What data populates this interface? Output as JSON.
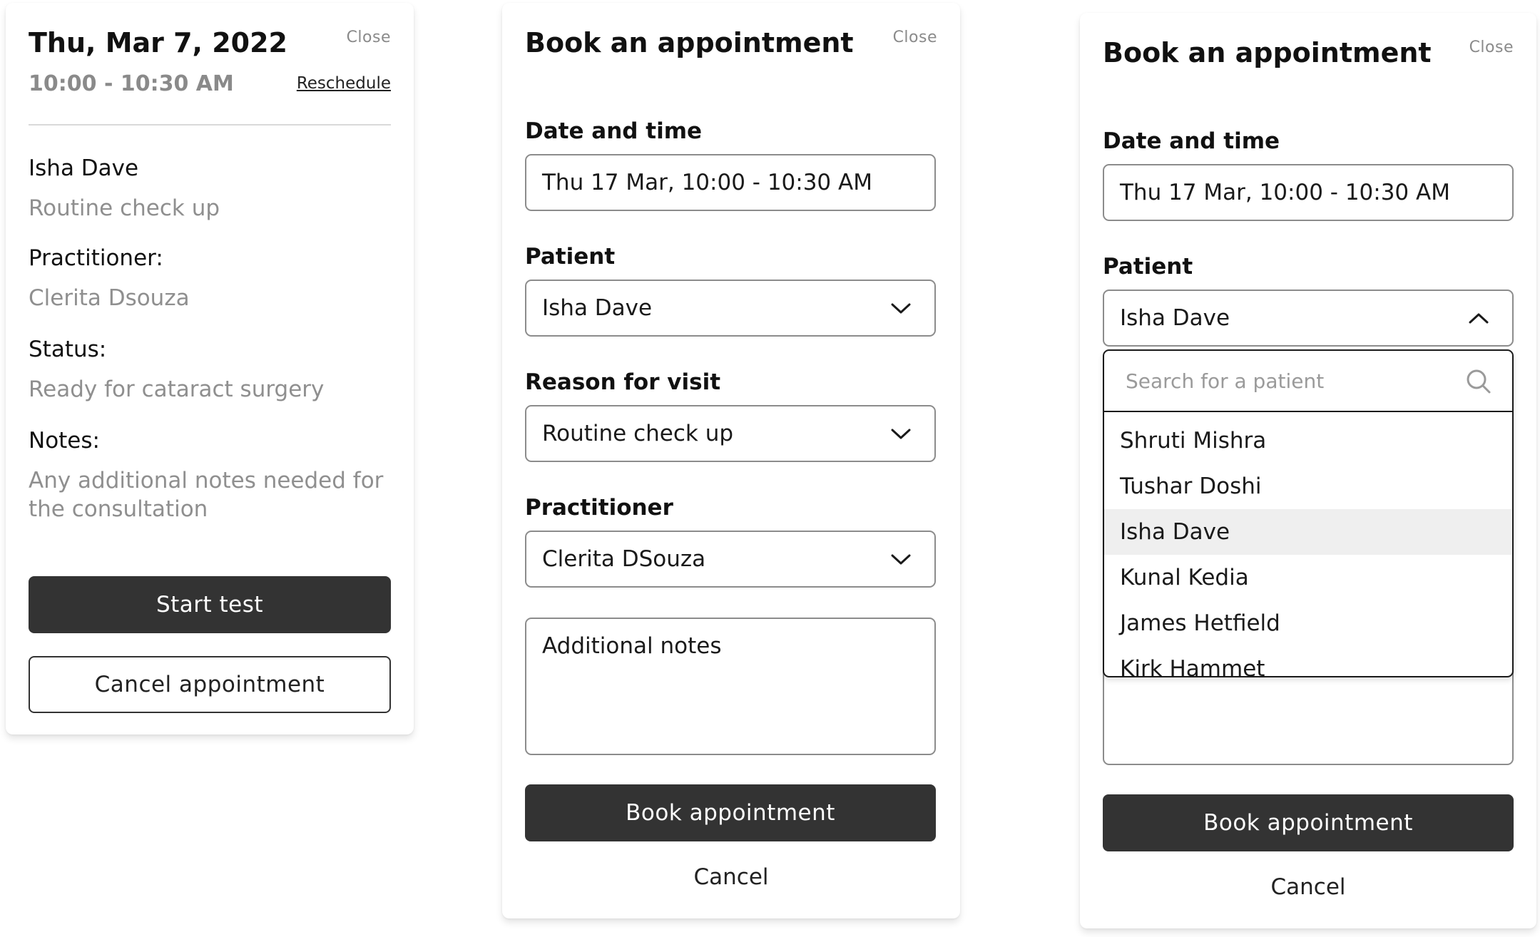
{
  "details_card": {
    "close_label": "Close",
    "date": "Thu, Mar 7, 2022",
    "time": "10:00 - 10:30 AM",
    "reschedule_label": "Reschedule",
    "patient_name": "Isha Dave",
    "visit_reason": "Routine check up",
    "practitioner_label": "Practitioner:",
    "practitioner_value": "Clerita Dsouza",
    "status_label": "Status:",
    "status_value": "Ready for cataract surgery",
    "notes_label": "Notes:",
    "notes_value": "Any additional notes needed for the consultation",
    "start_test_label": "Start test",
    "cancel_appointment_label": "Cancel appointment"
  },
  "booking_form": {
    "title": "Book an appointment",
    "close_label": "Close",
    "date_time_label": "Date and time",
    "date_time_value": "Thu 17 Mar, 10:00 - 10:30 AM",
    "patient_label": "Patient",
    "patient_value": "Isha Dave",
    "reason_label": "Reason for visit",
    "reason_value": "Routine check up",
    "practitioner_label": "Practitioner",
    "practitioner_value": "Clerita DSouza",
    "notes_placeholder": "Additional notes",
    "book_button_label": "Book appointment",
    "cancel_label": "Cancel"
  },
  "booking_form_open": {
    "title": "Book an appointment",
    "close_label": "Close",
    "date_time_label": "Date and time",
    "date_time_value": "Thu 17 Mar, 10:00 - 10:30 AM",
    "patient_label": "Patient",
    "patient_value": "Isha Dave",
    "book_button_label": "Book appointment",
    "cancel_label": "Cancel",
    "dropdown": {
      "search_placeholder": "Search for a patient",
      "options": [
        "Shruti Mishra",
        "Tushar Doshi",
        "Isha Dave",
        "Kunal Kedia",
        "James Hetfield",
        "Kirk Hammet"
      ],
      "selected": "Isha Dave"
    }
  },
  "colors": {
    "primary_button": "#333333",
    "muted_text": "#8a8a8a",
    "field_border": "#8c8c8c",
    "selected_option_bg": "#efefef"
  },
  "icons": {
    "dropdown_closed": "chevron-down-icon",
    "dropdown_open": "chevron-up-icon",
    "search": "search-icon"
  }
}
